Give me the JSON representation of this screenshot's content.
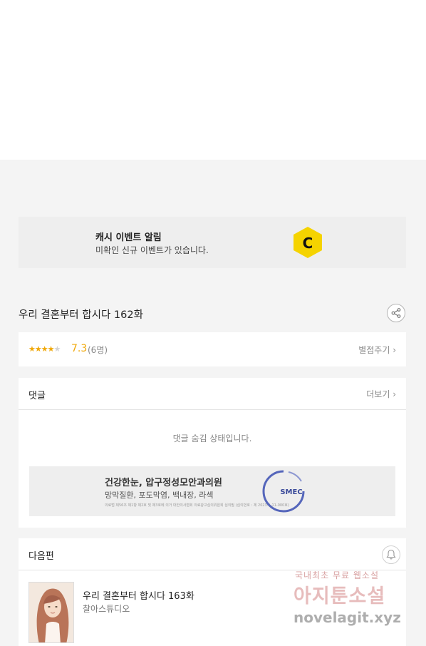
{
  "event": {
    "title": "캐시 이벤트 알림",
    "subtitle": "미확인 신규 이벤트가 있습니다.",
    "icon": "cash-c-icon",
    "icon_letter": "C",
    "icon_color": "#f5d300"
  },
  "episode": {
    "title": "우리 결혼부터 합시다 162화"
  },
  "rating": {
    "stars": "★★★★",
    "stars_empty": "★",
    "score": "7.3",
    "count": "(6명)",
    "rate_link": "별점주기 ›",
    "accent": "#f0a80a"
  },
  "comments": {
    "header": "댓글",
    "more": "더보기 ›",
    "hidden_message": "댓글 숨김 상태입니다."
  },
  "ad": {
    "title": "건강한눈, 압구정성모안과의원",
    "subtitle": "망막질환, 포도막염, 백내장, 라섹",
    "fine_print": "의료법 제56조 제1항 제2호 및 제3호에 의거 대한의사협회 의료광고심의위원회 심의필 (심의번호 : 제 2023-1-11-000호)",
    "logo_text": "SMEC",
    "logo_color": "#5566bb"
  },
  "next": {
    "header": "다음편",
    "title": "우리 결혼부터 합시다 163화",
    "studio": "찰아스튜디오"
  },
  "watermark": {
    "line1": "국내최초 무료 웹소설",
    "line2": "아지툰소설",
    "line3": "novelagit.xyz"
  }
}
